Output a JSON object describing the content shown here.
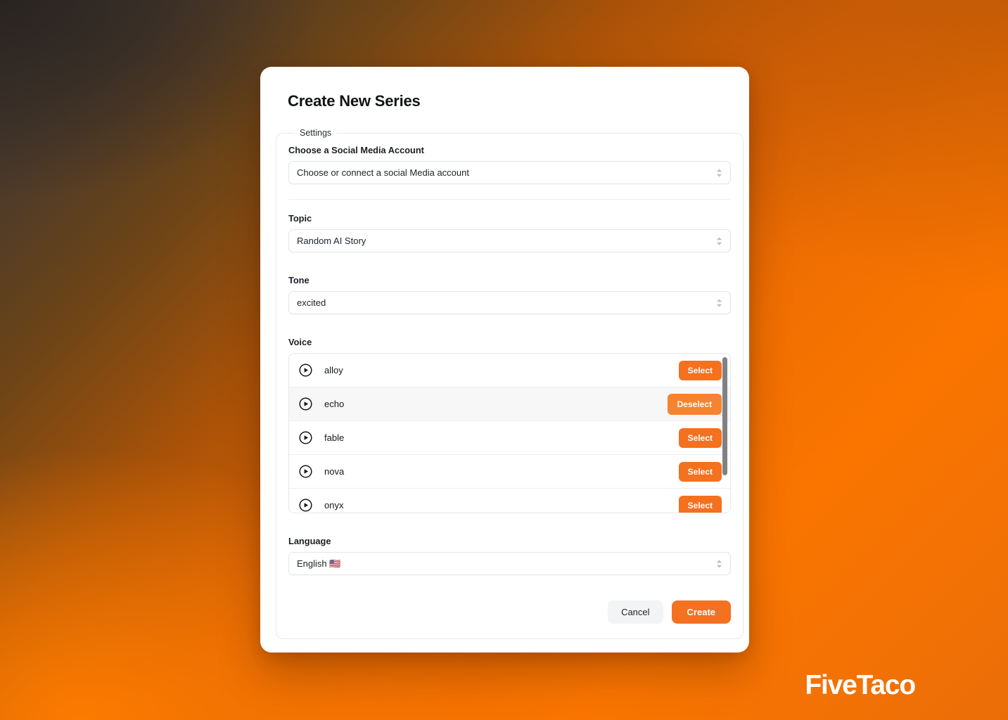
{
  "background": {
    "gradient_from": "#3a322c",
    "gradient_mid": "#d96205",
    "gradient_to": "#fa7500"
  },
  "modal": {
    "title": "Create New Series",
    "legend": "Settings",
    "accent_color": "#f4711f",
    "social": {
      "label": "Choose a Social Media Account",
      "value": "Choose or connect a social Media account"
    },
    "topic": {
      "label": "Topic",
      "value": "Random AI Story"
    },
    "tone": {
      "label": "Tone",
      "value": "excited"
    },
    "voice": {
      "label": "Voice",
      "select_label": "Select",
      "deselect_label": "Deselect",
      "items": [
        {
          "name": "alloy",
          "action": "Select",
          "selected": false
        },
        {
          "name": "echo",
          "action": "Deselect",
          "selected": true
        },
        {
          "name": "fable",
          "action": "Select",
          "selected": false
        },
        {
          "name": "nova",
          "action": "Select",
          "selected": false
        },
        {
          "name": "onyx",
          "action": "Select",
          "selected": false
        }
      ]
    },
    "language": {
      "label": "Language",
      "value": "English 🇺🇸"
    },
    "footer": {
      "cancel_label": "Cancel",
      "create_label": "Create"
    }
  },
  "brand": {
    "name": "FiveTaco"
  }
}
